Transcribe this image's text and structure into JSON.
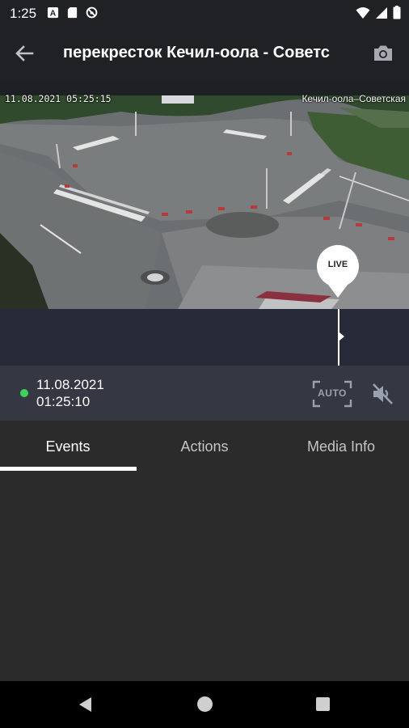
{
  "status_bar": {
    "time": "1:25",
    "left_icons": [
      "font-icon",
      "sd-card-icon",
      "blocked-icon"
    ],
    "right_icons": [
      "wifi-icon",
      "signal-icon",
      "battery-icon"
    ]
  },
  "app_bar": {
    "title": "перекресток Кечил-оола - Советс"
  },
  "video": {
    "overlay_datetime": "11.08.2021 05:25:15",
    "overlay_camera_name": "Кечил-оола–Советская",
    "live_label": "LIVE"
  },
  "info_bar": {
    "date": "11.08.2021",
    "time": "01:25:10",
    "auto_label": "AUTO",
    "live_dot_color": "#3ad35a"
  },
  "tabs": [
    {
      "label": "Events",
      "active": true
    },
    {
      "label": "Actions",
      "active": false
    },
    {
      "label": "Media Info",
      "active": false
    }
  ],
  "colors": {
    "app_bar": "#202125",
    "timeline": "#272a38",
    "info_bar": "#353743",
    "background": "#2a2a2a"
  }
}
